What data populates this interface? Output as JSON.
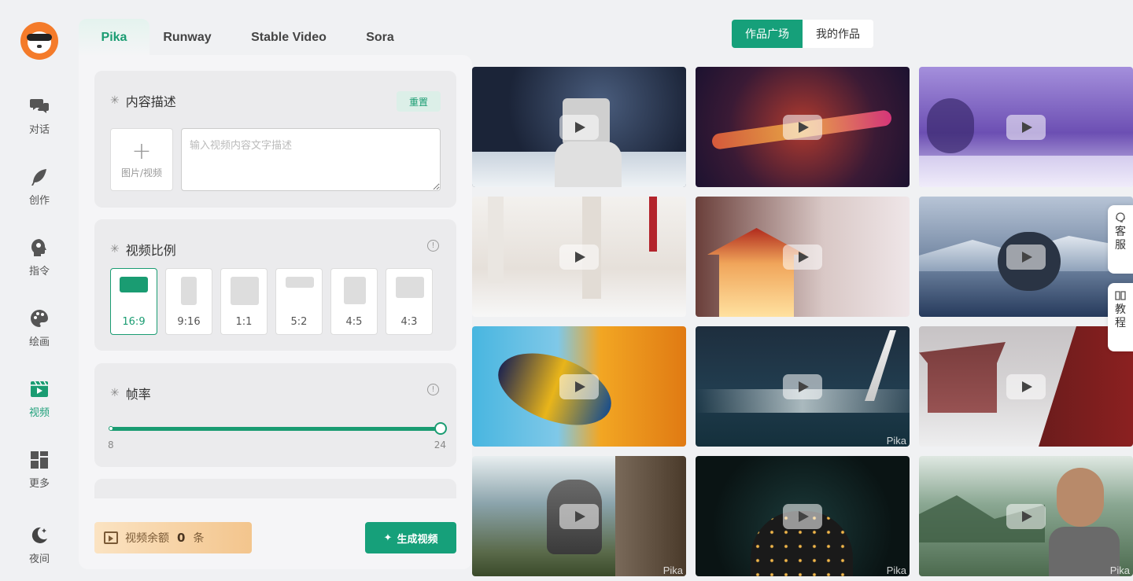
{
  "nav": {
    "items": [
      {
        "label": "对话",
        "icon": "chat-icon"
      },
      {
        "label": "创作",
        "icon": "feather-icon"
      },
      {
        "label": "指令",
        "icon": "head-brain-icon"
      },
      {
        "label": "绘画",
        "icon": "palette-icon"
      },
      {
        "label": "视频",
        "icon": "video-icon",
        "active": true
      },
      {
        "label": "更多",
        "icon": "grid-icon"
      },
      {
        "label": "夜间",
        "icon": "moon-icon"
      }
    ],
    "accent": "#1a9c72"
  },
  "tabs": [
    "Pika",
    "Runway",
    "Stable Video",
    "Sora"
  ],
  "active_tab": "Pika",
  "description": {
    "title": "内容描述",
    "reset_label": "重置",
    "upload_label": "图片/视频",
    "placeholder": "输入视频内容文字描述",
    "value": ""
  },
  "ratio": {
    "title": "视频比例",
    "options": [
      "16:9",
      "9:16",
      "1:1",
      "5:2",
      "4:5",
      "4:3"
    ],
    "selected": "16:9"
  },
  "framerate": {
    "title": "帧率",
    "min_label": "8",
    "max_label": "24",
    "value": 24
  },
  "footer": {
    "balance_prefix": "视频余额",
    "balance_count": "0",
    "balance_unit": "条",
    "generate_label": "生成视频"
  },
  "gallery": {
    "segments": [
      "作品广场",
      "我的作品"
    ],
    "active_segment": "作品广场",
    "watermark": "Pika"
  },
  "float_buttons": [
    {
      "label": "客服",
      "icon": "customer-service-icon"
    },
    {
      "label": "教程",
      "icon": "book-icon"
    }
  ]
}
